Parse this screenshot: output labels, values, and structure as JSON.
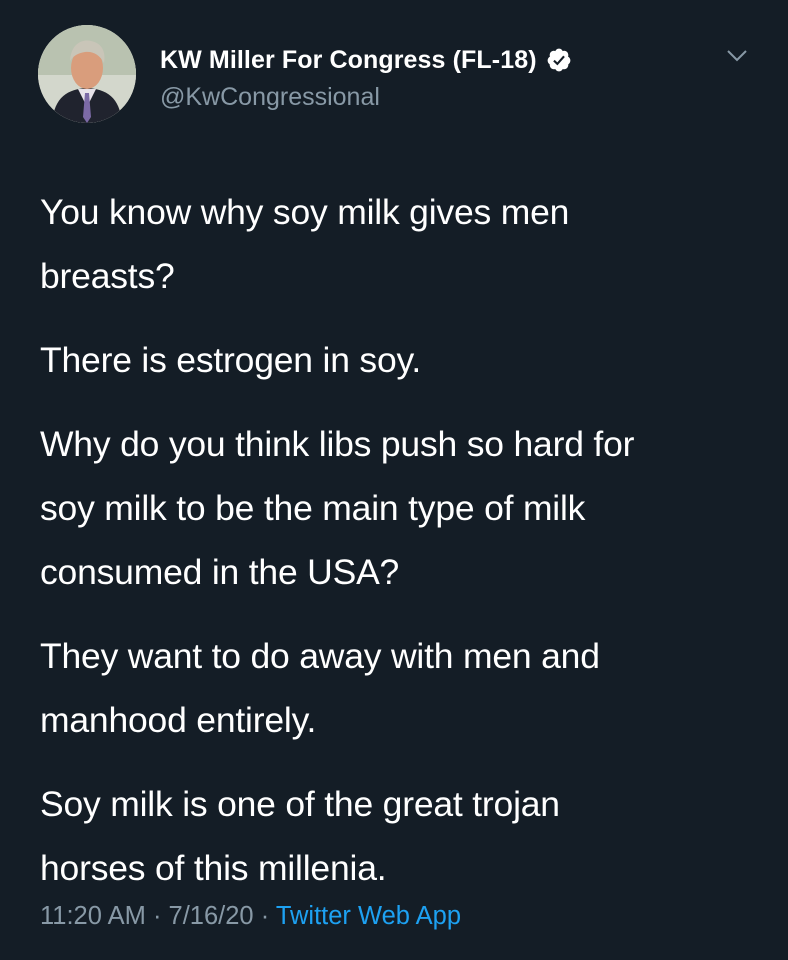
{
  "author": {
    "display_name": "KW Miller For Congress (FL-18)",
    "handle": "@KwCongressional",
    "verified_icon": "verified-badge-icon"
  },
  "tweet": {
    "paragraphs": [
      "You know why soy milk gives men\nbreasts?",
      "There is estrogen in soy.",
      "Why do you think libs push so hard for\nsoy milk to be the main type of milk\nconsumed in the USA?",
      "They want to do away with men and\nmanhood entirely.",
      "Soy milk is one of the great trojan\nhorses of this millenia."
    ],
    "time": "11:20 AM",
    "separator_1": " · ",
    "date": "7/16/20",
    "separator_2": " · ",
    "source": "Twitter Web App"
  },
  "colors": {
    "background": "#141d26",
    "text": "#ffffff",
    "muted": "#8899a6",
    "link": "#1da1f2"
  },
  "icons": {
    "menu": "chevron-down-icon"
  }
}
